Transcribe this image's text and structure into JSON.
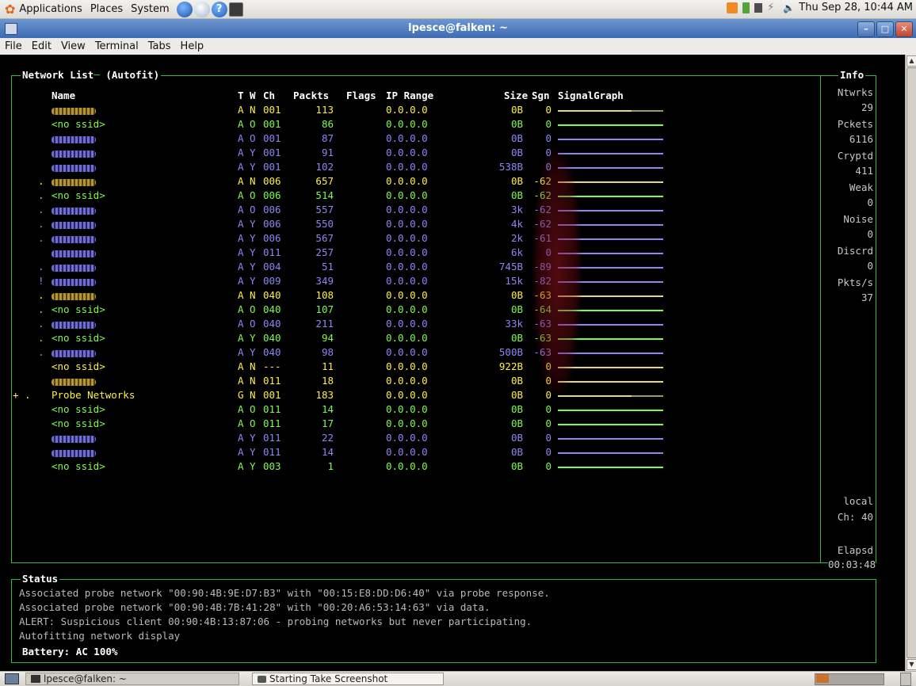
{
  "top_panel": {
    "menus": [
      "Applications",
      "Places",
      "System"
    ],
    "clock": "Thu Sep 28, 10:44 AM"
  },
  "window": {
    "title": "lpesce@falken: ~",
    "menus": [
      "File",
      "Edit",
      "View",
      "Terminal",
      "Tabs",
      "Help"
    ]
  },
  "network_list": {
    "title": "Network List",
    "subtitle": "(Autofit)",
    "headers": {
      "name": "Name",
      "t": "T",
      "w": "W",
      "ch": "Ch",
      "packets": "Packts",
      "flags": "Flags",
      "ip": "IP Range",
      "size": "Size",
      "sgn": "Sgn",
      "graph": "SignalGraph"
    },
    "rows": [
      {
        "prefix": "  ",
        "name": "",
        "t": "A",
        "w": "N",
        "ch": "001",
        "packets": "113",
        "ip": "0.0.0.0",
        "size": "0B",
        "sgn": "0",
        "color": "y",
        "sgcolor": "#e8d77a",
        "sgfill": 0.7
      },
      {
        "prefix": "  ",
        "name": "<no ssid>",
        "t": "A",
        "w": "O",
        "ch": "001",
        "packets": "86",
        "ip": "0.0.0.0",
        "size": "0B",
        "sgn": "0",
        "color": "g",
        "sgcolor": "#7cfc4a",
        "sgfill": 1.0
      },
      {
        "prefix": "  ",
        "name": "",
        "t": "A",
        "w": "O",
        "ch": "001",
        "packets": "87",
        "ip": "0.0.0.0",
        "size": "0B",
        "sgn": "0",
        "color": "b",
        "sgcolor": "#8d86f5",
        "sgfill": 1.0
      },
      {
        "prefix": "  ",
        "name": "",
        "t": "A",
        "w": "Y",
        "ch": "001",
        "packets": "91",
        "ip": "0.0.0.0",
        "size": "0B",
        "sgn": "0",
        "color": "b",
        "sgcolor": "#8d86f5",
        "sgfill": 1.0
      },
      {
        "prefix": "  ",
        "name": "",
        "t": "A",
        "w": "Y",
        "ch": "001",
        "packets": "102",
        "ip": "0.0.0.0",
        "size": "538B",
        "sgn": "0",
        "color": "b",
        "sgcolor": "#8d86f5",
        "sgfill": 1.0
      },
      {
        "prefix": ". ",
        "name": "",
        "t": "A",
        "w": "N",
        "ch": "006",
        "packets": "657",
        "ip": "0.0.0.0",
        "size": "0B",
        "sgn": "-62",
        "color": "y",
        "sgcolor": "#e8d77a",
        "sgfill": 1.0
      },
      {
        "prefix": ". ",
        "name": "<no ssid>",
        "t": "A",
        "w": "O",
        "ch": "006",
        "packets": "514",
        "ip": "0.0.0.0",
        "size": "0B",
        "sgn": "-62",
        "color": "g",
        "sgcolor": "#7cfc4a",
        "sgfill": 1.0
      },
      {
        "prefix": ". ",
        "name": "",
        "t": "A",
        "w": "O",
        "ch": "006",
        "packets": "557",
        "ip": "0.0.0.0",
        "size": "3k",
        "sgn": "-62",
        "color": "b",
        "sgcolor": "#8d86f5",
        "sgfill": 1.0
      },
      {
        "prefix": ". ",
        "name": "",
        "t": "A",
        "w": "Y",
        "ch": "006",
        "packets": "550",
        "ip": "0.0.0.0",
        "size": "4k",
        "sgn": "-62",
        "color": "b",
        "sgcolor": "#8d86f5",
        "sgfill": 1.0
      },
      {
        "prefix": ". ",
        "name": "",
        "t": "A",
        "w": "Y",
        "ch": "006",
        "packets": "567",
        "ip": "0.0.0.0",
        "size": "2k",
        "sgn": "-61",
        "color": "b",
        "sgcolor": "#8d86f5",
        "sgfill": 1.0
      },
      {
        "prefix": "  ",
        "name": "",
        "t": "A",
        "w": "Y",
        "ch": "011",
        "packets": "257",
        "ip": "0.0.0.0",
        "size": "6k",
        "sgn": "0",
        "color": "b",
        "sgcolor": "#8d86f5",
        "sgfill": 1.0
      },
      {
        "prefix": ". ",
        "name": "",
        "t": "A",
        "w": "Y",
        "ch": "004",
        "packets": "51",
        "ip": "0.0.0.0",
        "size": "745B",
        "sgn": "-89",
        "color": "b",
        "sgcolor": "#8d86f5",
        "sgfill": 1.0
      },
      {
        "prefix": "! ",
        "name": "",
        "t": "A",
        "w": "Y",
        "ch": "009",
        "packets": "349",
        "ip": "0.0.0.0",
        "size": "15k",
        "sgn": "-82",
        "color": "b",
        "sgcolor": "#8d86f5",
        "sgfill": 1.0
      },
      {
        "prefix": ". ",
        "name": "",
        "t": "A",
        "w": "N",
        "ch": "040",
        "packets": "108",
        "ip": "0.0.0.0",
        "size": "0B",
        "sgn": "-63",
        "color": "y",
        "sgcolor": "#e8d77a",
        "sgfill": 1.0
      },
      {
        "prefix": ". ",
        "name": "<no ssid>",
        "t": "A",
        "w": "O",
        "ch": "040",
        "packets": "107",
        "ip": "0.0.0.0",
        "size": "0B",
        "sgn": "-64",
        "color": "g",
        "sgcolor": "#7cfc4a",
        "sgfill": 1.0
      },
      {
        "prefix": ". ",
        "name": "",
        "t": "A",
        "w": "O",
        "ch": "040",
        "packets": "211",
        "ip": "0.0.0.0",
        "size": "33k",
        "sgn": "-63",
        "color": "b",
        "sgcolor": "#8d86f5",
        "sgfill": 1.0
      },
      {
        "prefix": ". ",
        "name": "<no ssid>",
        "t": "A",
        "w": "Y",
        "ch": "040",
        "packets": "94",
        "ip": "0.0.0.0",
        "size": "0B",
        "sgn": "-63",
        "color": "g",
        "sgcolor": "#7cfc4a",
        "sgfill": 1.0
      },
      {
        "prefix": ". ",
        "name": "",
        "t": "A",
        "w": "Y",
        "ch": "040",
        "packets": "98",
        "ip": "0.0.0.0",
        "size": "500B",
        "sgn": "-63",
        "color": "b",
        "sgcolor": "#8d86f5",
        "sgfill": 1.0
      },
      {
        "prefix": "  ",
        "name": "<no ssid>",
        "t": "A",
        "w": "N",
        "ch": "---",
        "packets": "11",
        "ip": "0.0.0.0",
        "size": "922B",
        "sgn": "0",
        "color": "y",
        "sgcolor": "#e8d77a",
        "sgfill": 1.0
      },
      {
        "prefix": "  ",
        "name": "",
        "t": "A",
        "w": "N",
        "ch": "011",
        "packets": "18",
        "ip": "0.0.0.0",
        "size": "0B",
        "sgn": "0",
        "color": "y",
        "sgcolor": "#e8d77a",
        "sgfill": 1.0
      },
      {
        "prefix": "+ .",
        "name": "Probe Networks",
        "t": "G",
        "w": "N",
        "ch": "001",
        "packets": "183",
        "ip": "0.0.0.0",
        "size": "0B",
        "sgn": "0",
        "color": "y",
        "sgcolor": "#e8d77a",
        "sgfill": 0.7
      },
      {
        "prefix": "  ",
        "name": "<no ssid>",
        "t": "A",
        "w": "O",
        "ch": "011",
        "packets": "14",
        "ip": "0.0.0.0",
        "size": "0B",
        "sgn": "0",
        "color": "g",
        "sgcolor": "#7cfc4a",
        "sgfill": 1.0
      },
      {
        "prefix": "  ",
        "name": "<no ssid>",
        "t": "A",
        "w": "O",
        "ch": "011",
        "packets": "17",
        "ip": "0.0.0.0",
        "size": "0B",
        "sgn": "0",
        "color": "g",
        "sgcolor": "#7cfc4a",
        "sgfill": 1.0
      },
      {
        "prefix": "  ",
        "name": "",
        "t": "A",
        "w": "Y",
        "ch": "011",
        "packets": "22",
        "ip": "0.0.0.0",
        "size": "0B",
        "sgn": "0",
        "color": "b",
        "sgcolor": "#8d86f5",
        "sgfill": 1.0
      },
      {
        "prefix": "  ",
        "name": "",
        "t": "A",
        "w": "Y",
        "ch": "011",
        "packets": "14",
        "ip": "0.0.0.0",
        "size": "0B",
        "sgn": "0",
        "color": "b",
        "sgcolor": "#8d86f5",
        "sgfill": 1.0
      },
      {
        "prefix": "  ",
        "name": "<no ssid>",
        "t": "A",
        "w": "Y",
        "ch": "003",
        "packets": "1",
        "ip": "0.0.0.0",
        "size": "0B",
        "sgn": "0",
        "color": "g",
        "sgcolor": "#7cfc4a",
        "sgfill": 1.0
      }
    ]
  },
  "info": {
    "title": "Info",
    "items": [
      {
        "label": "Ntwrks",
        "value": "29"
      },
      {
        "label": "Pckets",
        "value": "6116"
      },
      {
        "label": "Cryptd",
        "value": "411"
      },
      {
        "label": "Weak",
        "value": "0"
      },
      {
        "label": "Noise",
        "value": "0"
      },
      {
        "label": "Discrd",
        "value": "0"
      },
      {
        "label": "Pkts/s",
        "value": "37"
      }
    ],
    "local_label": "local",
    "ch_label": "Ch: 40",
    "elapsed_label": "Elapsd",
    "elapsed_value": "00:03:48"
  },
  "status": {
    "title": "Status",
    "lines": [
      "Associated probe network \"00:90:4B:9E:D7:B3\" with \"00:15:E8:DD:D6:40\" via probe response.",
      "Associated probe network \"00:90:4B:7B:41:28\" with \"00:20:A6:53:14:63\" via data.",
      "ALERT: Suspicious client 00:90:4B:13:87:06 - probing networks but never participating.",
      "Autofitting network display"
    ],
    "battery": "Battery: AC 100%"
  },
  "taskbar": {
    "items": [
      "lpesce@falken: ~",
      "Starting Take Screenshot"
    ]
  },
  "colors": {
    "y": "#ffee44",
    "g": "#7cfc4a",
    "b": "#8d86f5",
    "border": "#39b54a"
  }
}
